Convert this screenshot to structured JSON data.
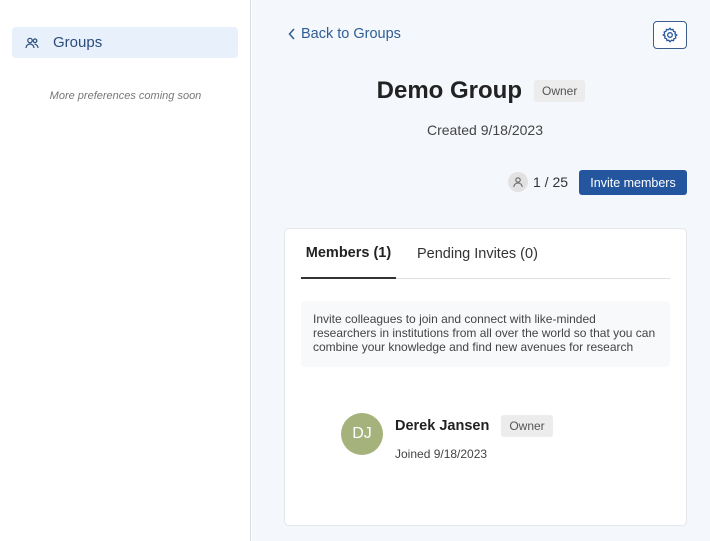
{
  "sidebar": {
    "items": [
      {
        "label": "Groups",
        "icon": "users-icon"
      }
    ],
    "note": "More preferences coming soon"
  },
  "header": {
    "back_label": "Back to Groups",
    "settings_icon": "gear-icon"
  },
  "group": {
    "title": "Demo Group",
    "role_badge": "Owner",
    "created": "Created 9/18/2023",
    "member_count": "1 / 25",
    "invite_label": "Invite members"
  },
  "tabs": [
    {
      "label": "Members (1)",
      "active": true
    },
    {
      "label": "Pending Invites (0)",
      "active": false
    }
  ],
  "info_text": "Invite colleagues to join and connect with like-minded researchers in institutions from all over the world so that you can combine your knowledge and find new avenues for research",
  "members": [
    {
      "initials": "DJ",
      "name": "Derek Jansen",
      "role": "Owner",
      "joined": "Joined 9/18/2023"
    }
  ],
  "colors": {
    "accent": "#2456a0",
    "sidebar_active_bg": "#e8f0fb",
    "main_bg": "#f4f7fb",
    "avatar_bg": "#a6b27c"
  }
}
